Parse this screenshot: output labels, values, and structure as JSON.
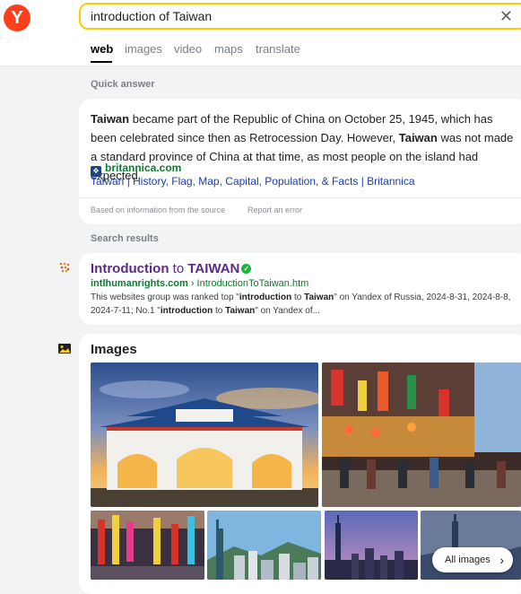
{
  "brand": {
    "logo_letter": "Y",
    "logo_color": "#fc3f1d",
    "accent": "#ffcc00"
  },
  "search": {
    "query": "introduction of Taiwan",
    "clear_icon": "close-icon"
  },
  "tabs": [
    {
      "label": "web",
      "active": true
    },
    {
      "label": "images",
      "active": false
    },
    {
      "label": "video",
      "active": false
    },
    {
      "label": "maps",
      "active": false
    },
    {
      "label": "translate",
      "active": false
    }
  ],
  "quick_answer": {
    "label": "Quick answer",
    "text_parts": [
      {
        "t": "Taiwan",
        "bold": true
      },
      {
        "t": " became part of the Republic of China on October 25, 1945, which has been celebrated since then as Retrocession Day. However, ",
        "bold": false
      },
      {
        "t": "Taiwan",
        "bold": true
      },
      {
        "t": " was not made a standard province of China at that time, as most people on the island had expected.",
        "bold": false
      }
    ],
    "source_domain": "britannica.com",
    "source_title": "Taiwan | History, Flag, Map, Capital, Population, & Facts | Britannica",
    "footnote": "Based on information from the source",
    "report_link": "Report an error"
  },
  "results": {
    "label": "Search results",
    "items": [
      {
        "title_bold_1": "Introduction",
        "title_light": " to ",
        "title_bold_2": "TAIWAN",
        "domain": "intlhumanrights.com",
        "path": " › IntroductionToTaiwan.htm",
        "snippet_parts": [
          {
            "t": "This websites group was ranked top \"",
            "bold": false
          },
          {
            "t": "introduction",
            "bold": true
          },
          {
            "t": " to ",
            "bold": false
          },
          {
            "t": "Taiwan",
            "bold": true
          },
          {
            "t": "\" on Yandex of Russia, 2024-8-31, 2024-8-8, 2024-7-11; No.1 \"",
            "bold": false
          },
          {
            "t": "introduction",
            "bold": true
          },
          {
            "t": " to ",
            "bold": false
          },
          {
            "t": "Taiwan",
            "bold": true
          },
          {
            "t": "\" on Yandex of...",
            "bold": false
          }
        ]
      }
    ]
  },
  "images": {
    "heading": "Images",
    "all_images_label": "All images"
  }
}
